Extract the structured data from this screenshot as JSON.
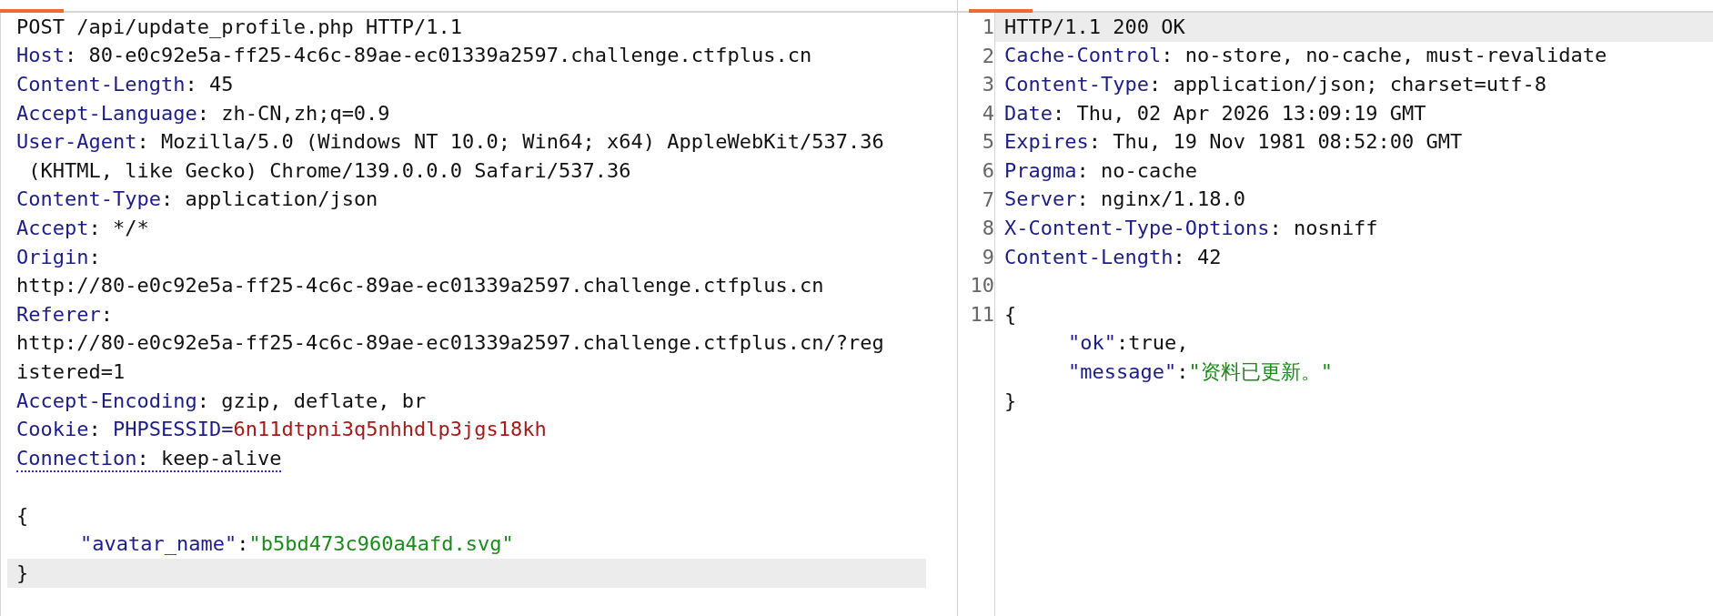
{
  "request": {
    "lines": [
      {
        "parts": [
          {
            "kind": "text",
            "text": "POST /api/update_profile.php HTTP/1.1"
          }
        ],
        "highlighted": false,
        "flagged": false
      },
      {
        "parts": [
          {
            "kind": "name",
            "text": "Host"
          },
          {
            "kind": "text",
            "text": ": 80-e0c92e5a-ff25-4c6c-89ae-ec01339a2597.challenge.ctfplus.cn"
          }
        ],
        "highlighted": false,
        "flagged": false
      },
      {
        "parts": [
          {
            "kind": "name",
            "text": "Content-Length"
          },
          {
            "kind": "text",
            "text": ": 45"
          }
        ],
        "highlighted": false,
        "flagged": false
      },
      {
        "parts": [
          {
            "kind": "name",
            "text": "Accept-Language"
          },
          {
            "kind": "text",
            "text": ": zh-CN,zh;q=0.9"
          }
        ],
        "highlighted": false,
        "flagged": false
      },
      {
        "parts": [
          {
            "kind": "name",
            "text": "User-Agent"
          },
          {
            "kind": "text",
            "text": ": Mozilla/5.0 (Windows NT 10.0; Win64; x64) AppleWebKit/537.36"
          }
        ],
        "highlighted": false,
        "flagged": false
      },
      {
        "parts": [
          {
            "kind": "text",
            "text": " (KHTML, like Gecko) Chrome/139.0.0.0 Safari/537.36"
          }
        ],
        "highlighted": false,
        "flagged": false
      },
      {
        "parts": [
          {
            "kind": "name",
            "text": "Content-Type"
          },
          {
            "kind": "text",
            "text": ": application/json"
          }
        ],
        "highlighted": false,
        "flagged": false
      },
      {
        "parts": [
          {
            "kind": "name",
            "text": "Accept"
          },
          {
            "kind": "text",
            "text": ": */*"
          }
        ],
        "highlighted": false,
        "flagged": false
      },
      {
        "parts": [
          {
            "kind": "name",
            "text": "Origin"
          },
          {
            "kind": "text",
            "text": ":"
          }
        ],
        "highlighted": false,
        "flagged": false
      },
      {
        "parts": [
          {
            "kind": "text",
            "text": "http://80-e0c92e5a-ff25-4c6c-89ae-ec01339a2597.challenge.ctfplus.cn"
          }
        ],
        "highlighted": false,
        "flagged": false
      },
      {
        "parts": [
          {
            "kind": "name",
            "text": "Referer"
          },
          {
            "kind": "text",
            "text": ":"
          }
        ],
        "highlighted": false,
        "flagged": false
      },
      {
        "parts": [
          {
            "kind": "text",
            "text": "http://80-e0c92e5a-ff25-4c6c-89ae-ec01339a2597.challenge.ctfplus.cn/?reg"
          }
        ],
        "highlighted": false,
        "flagged": false
      },
      {
        "parts": [
          {
            "kind": "text",
            "text": "istered=1"
          }
        ],
        "highlighted": false,
        "flagged": false
      },
      {
        "parts": [
          {
            "kind": "name",
            "text": "Accept-Encoding"
          },
          {
            "kind": "text",
            "text": ": gzip, deflate, br"
          }
        ],
        "highlighted": false,
        "flagged": false
      },
      {
        "parts": [
          {
            "kind": "name",
            "text": "Cookie"
          },
          {
            "kind": "text",
            "text": ": "
          },
          {
            "kind": "name",
            "text": "PHPSESSID="
          },
          {
            "kind": "cookie",
            "text": "6n11dtpni3q5nhhdlp3jgs18kh"
          }
        ],
        "highlighted": false,
        "flagged": false
      },
      {
        "parts": [
          {
            "kind": "name",
            "text": "Connection"
          },
          {
            "kind": "text",
            "text": ": keep-alive"
          }
        ],
        "highlighted": false,
        "flagged": true
      },
      {
        "highlighted": false,
        "flagged": false
      },
      {
        "parts": [
          {
            "kind": "text",
            "text": "{"
          }
        ],
        "highlighted": false,
        "flagged": false,
        "children": [
          {
            "parts": [
              {
                "kind": "name",
                "text": "\"avatar_name\""
              },
              {
                "kind": "text",
                "text": ":"
              },
              {
                "kind": "string",
                "text": "\"b5bd473c960a4afd.svg\""
              }
            ],
            "highlighted": false,
            "flagged": false
          }
        ]
      },
      {
        "parts": [
          {
            "kind": "text",
            "text": "}"
          }
        ],
        "highlighted": true,
        "flagged": false
      }
    ]
  },
  "response": {
    "lines": [
      {
        "number": "1",
        "parts": [
          {
            "kind": "text",
            "text": "HTTP/1.1 200 OK"
          }
        ],
        "highlighted": true
      },
      {
        "number": "2",
        "parts": [
          {
            "kind": "name",
            "text": "Cache-Control"
          },
          {
            "kind": "text",
            "text": ": no-store, no-cache, must-revalidate"
          }
        ],
        "highlighted": false
      },
      {
        "number": "3",
        "parts": [
          {
            "kind": "name",
            "text": "Content-Type"
          },
          {
            "kind": "text",
            "text": ": application/json; charset=utf-8"
          }
        ],
        "highlighted": false
      },
      {
        "number": "4",
        "parts": [
          {
            "kind": "name",
            "text": "Date"
          },
          {
            "kind": "text",
            "text": ": Thu, 02 Apr 2026 13:09:19 GMT"
          }
        ],
        "highlighted": false
      },
      {
        "number": "5",
        "parts": [
          {
            "kind": "name",
            "text": "Expires"
          },
          {
            "kind": "text",
            "text": ": Thu, 19 Nov 1981 08:52:00 GMT"
          }
        ],
        "highlighted": false
      },
      {
        "number": "6",
        "parts": [
          {
            "kind": "name",
            "text": "Pragma"
          },
          {
            "kind": "text",
            "text": ": no-cache"
          }
        ],
        "highlighted": false
      },
      {
        "number": "7",
        "parts": [
          {
            "kind": "name",
            "text": "Server"
          },
          {
            "kind": "text",
            "text": ": nginx/1.18.0"
          }
        ],
        "highlighted": false
      },
      {
        "number": "8",
        "parts": [
          {
            "kind": "name",
            "text": "X-Content-Type-Options"
          },
          {
            "kind": "text",
            "text": ": nosniff"
          }
        ],
        "highlighted": false
      },
      {
        "number": "9",
        "parts": [
          {
            "kind": "name",
            "text": "Content-Length"
          },
          {
            "kind": "text",
            "text": ": 42"
          }
        ],
        "highlighted": false
      },
      {
        "number": "10",
        "highlighted": false
      },
      {
        "number": "11",
        "parts": [
          {
            "kind": "text",
            "text": "{"
          }
        ],
        "highlighted": false,
        "children": [
          {
            "parts": [
              {
                "kind": "name",
                "text": "\"ok\""
              },
              {
                "kind": "text",
                "text": ":true,"
              }
            ],
            "highlighted": false
          },
          {
            "parts": [
              {
                "kind": "name",
                "text": "\"message\""
              },
              {
                "kind": "text",
                "text": ":"
              },
              {
                "kind": "string",
                "text": "\"资料已更新。\""
              }
            ],
            "highlighted": false
          }
        ]
      },
      {
        "parts": [
          {
            "kind": "text",
            "text": "}"
          }
        ],
        "highlighted": false
      }
    ]
  }
}
